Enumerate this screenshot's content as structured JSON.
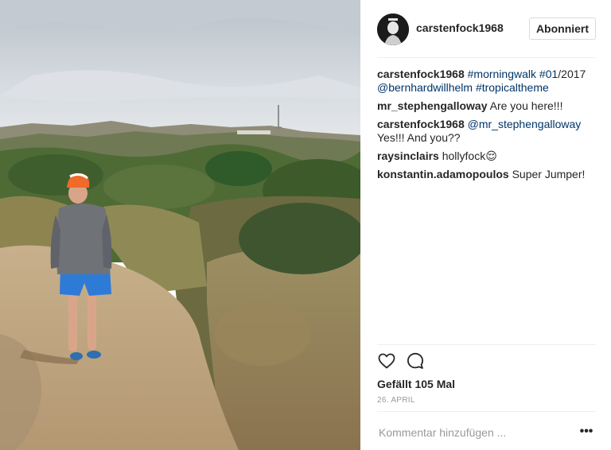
{
  "photo": {
    "alt_scene": "hiker-on-trail-hollywood-hills"
  },
  "header": {
    "username": "carstenfock1968",
    "follow_label": "Abonniert"
  },
  "caption": {
    "username": "carstenfock1968",
    "parts": [
      {
        "text": "#morningwalk",
        "type": "link"
      },
      {
        "text": " ",
        "type": "text"
      },
      {
        "text": "#01",
        "type": "link"
      },
      {
        "text": "/2017 ",
        "type": "text"
      },
      {
        "text": "@bernhardwillhelm",
        "type": "link"
      },
      {
        "text": " ",
        "type": "text"
      },
      {
        "text": "#tropicaltheme",
        "type": "link"
      }
    ]
  },
  "comments": [
    {
      "username": "mr_stephengalloway",
      "mention": "",
      "text": "Are you here!!!"
    },
    {
      "username": "carstenfock1968",
      "mention": "@mr_stephengalloway",
      "text": "Yes!!! And you??"
    },
    {
      "username": "raysinclairs",
      "mention": "",
      "text": "hollyfock😌"
    },
    {
      "username": "konstantin.adamopoulos",
      "mention": "",
      "text": "Super Jumper!"
    }
  ],
  "actions": {
    "like_icon": "heart-icon",
    "comment_icon": "comment-icon"
  },
  "likes": "Gefällt 105 Mal",
  "date": "26. APRIL",
  "comment_box": {
    "placeholder": "Kommentar hinzufügen ...",
    "more_label": "•••"
  }
}
